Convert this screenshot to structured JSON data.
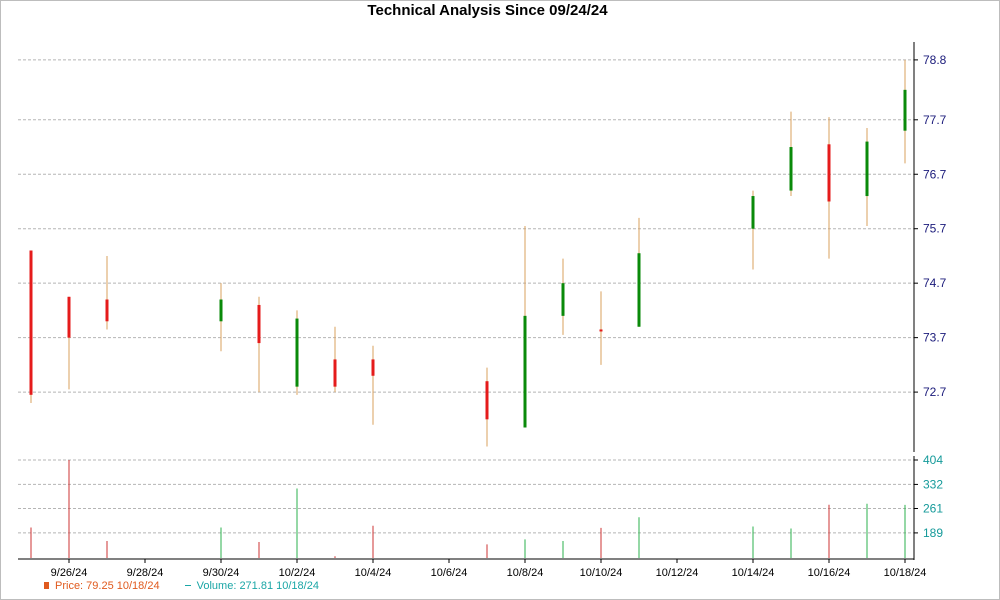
{
  "title": "Technical Analysis Since 09/24/24",
  "legend": {
    "price_label": "Price: 79.25  10/18/24",
    "volume_label": "Volume: 271.81  10/18/24"
  },
  "colors": {
    "up": "#0a8a0a",
    "down": "#e51b1b",
    "wick": "#d9a05e",
    "grid": "#b5b5b5",
    "price_axis_text": "#1a1a7a",
    "volume_axis_text": "#159a9a",
    "volume_up": "#2bb24c",
    "volume_down": "#cc3333"
  },
  "chart_data": {
    "type": "candlestick",
    "title": "Technical Analysis Since 09/24/24",
    "price_axis": {
      "ticks": [
        72.7,
        73.7,
        74.7,
        75.7,
        76.7,
        77.7,
        78.8
      ],
      "ylim": [
        71.6,
        79.0
      ]
    },
    "volume_axis": {
      "ticks": [
        189,
        261,
        332,
        404
      ],
      "ylim": [
        115,
        404
      ]
    },
    "x_tick_labels": [
      "9/26/24",
      "9/28/24",
      "9/30/24",
      "10/2/24",
      "10/4/24",
      "10/6/24",
      "10/8/24",
      "10/10/24",
      "10/12/24",
      "10/14/24",
      "10/16/24",
      "10/18/24"
    ],
    "candles": [
      {
        "date": "9/25/24",
        "open": 75.3,
        "high": 75.3,
        "low": 72.5,
        "close": 72.65,
        "volume": 205
      },
      {
        "date": "9/26/24",
        "open": 74.45,
        "high": 74.45,
        "low": 72.75,
        "close": 73.7,
        "volume": 404
      },
      {
        "date": "9/27/24",
        "open": 74.4,
        "high": 75.2,
        "low": 73.85,
        "close": 74.0,
        "volume": 165
      },
      {
        "date": "9/30/24",
        "open": 74.0,
        "high": 74.7,
        "low": 73.45,
        "close": 74.4,
        "volume": 205
      },
      {
        "date": "10/1/24",
        "open": 74.3,
        "high": 74.45,
        "low": 72.7,
        "close": 73.6,
        "volume": 162
      },
      {
        "date": "10/2/24",
        "open": 72.8,
        "high": 74.2,
        "low": 72.65,
        "close": 74.05,
        "volume": 320
      },
      {
        "date": "10/3/24",
        "open": 73.3,
        "high": 73.9,
        "low": 72.7,
        "close": 72.8,
        "volume": 120
      },
      {
        "date": "10/4/24",
        "open": 73.3,
        "high": 73.55,
        "low": 72.1,
        "close": 73.0,
        "volume": 210
      },
      {
        "date": "10/7/24",
        "open": 72.9,
        "high": 73.15,
        "low": 71.7,
        "close": 72.2,
        "volume": 155
      },
      {
        "date": "10/8/24",
        "open": 72.05,
        "high": 75.75,
        "low": 72.05,
        "close": 74.1,
        "volume": 170
      },
      {
        "date": "10/9/24",
        "open": 74.1,
        "high": 75.15,
        "low": 73.75,
        "close": 74.7,
        "volume": 165
      },
      {
        "date": "10/10/24",
        "open": 73.85,
        "high": 74.55,
        "low": 73.2,
        "close": 73.83,
        "volume": 204
      },
      {
        "date": "10/11/24",
        "open": 73.9,
        "high": 75.9,
        "low": 73.9,
        "close": 75.25,
        "volume": 235
      },
      {
        "date": "10/14/24",
        "open": 75.7,
        "high": 76.4,
        "low": 74.95,
        "close": 76.3,
        "volume": 208
      },
      {
        "date": "10/15/24",
        "open": 76.4,
        "high": 77.85,
        "low": 76.3,
        "close": 77.2,
        "volume": 202
      },
      {
        "date": "10/16/24",
        "open": 77.25,
        "high": 77.75,
        "low": 75.15,
        "close": 76.2,
        "volume": 272
      },
      {
        "date": "10/17/24",
        "open": 76.3,
        "high": 77.55,
        "low": 75.75,
        "close": 77.3,
        "volume": 275
      },
      {
        "date": "10/18/24",
        "open": 77.5,
        "high": 78.8,
        "low": 76.9,
        "close": 78.25,
        "volume": 271.81
      }
    ]
  }
}
